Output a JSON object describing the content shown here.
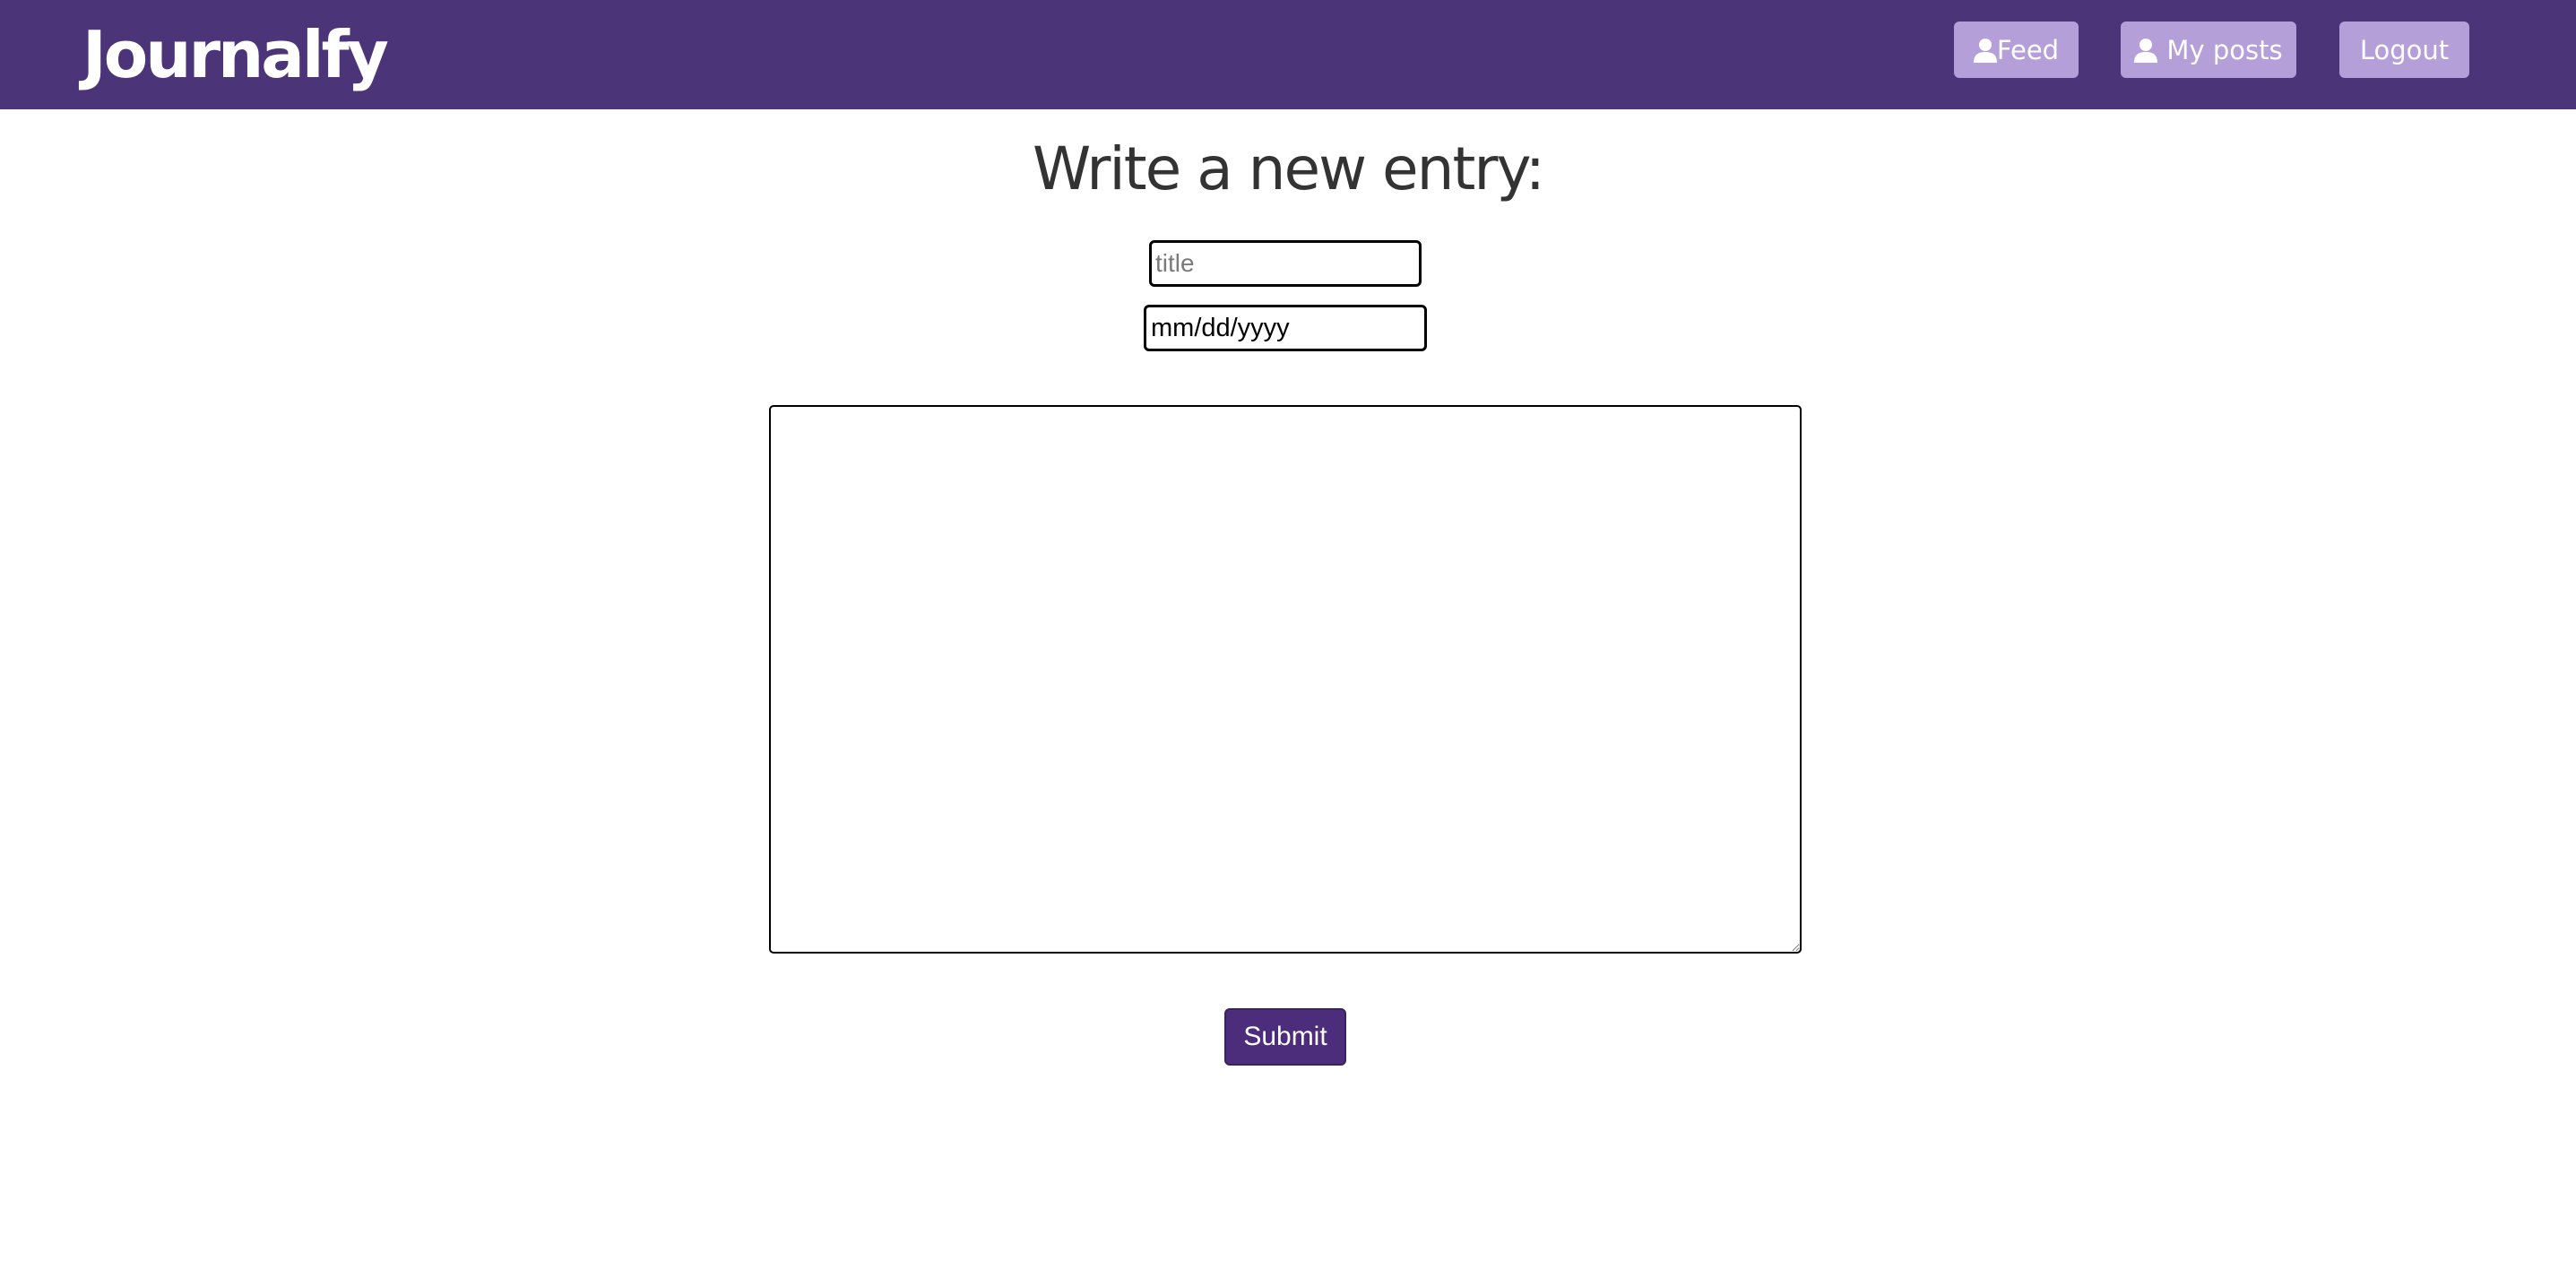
{
  "navbar": {
    "logo_text": "Journalfy",
    "buttons": [
      {
        "label": "Feed",
        "icon": "user-icon"
      },
      {
        "label": "My posts",
        "icon": "user-icon"
      },
      {
        "label": "Logout"
      }
    ],
    "background_color": "#4c3479",
    "button_color": "#b49fd9"
  },
  "main": {
    "heading": "Write a new entry:",
    "title_field": {
      "placeholder": "title",
      "value": ""
    },
    "date_field": {
      "value": "mm/dd/yyyy"
    },
    "body_field": {
      "value": ""
    },
    "submit_label": "Submit",
    "submit_color": "#4c2d7c"
  }
}
